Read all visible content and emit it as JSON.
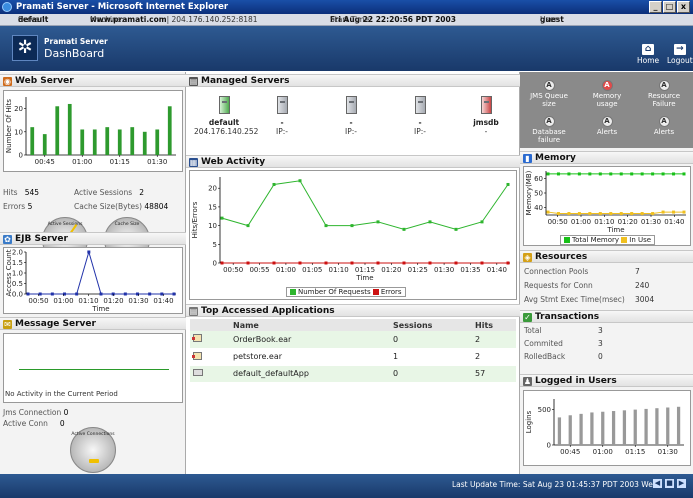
{
  "window": {
    "title": "Pramati Server - Microsoft Internet Explorer",
    "min": "_",
    "max": "□",
    "close": "x"
  },
  "infobar": {
    "server_label": "Server:",
    "server": "default",
    "machine_label": "Machine:",
    "machine": "www.pramati.com",
    "machine_addr": "| 204.176.140.252:8181",
    "start_label": "Start Time:",
    "start": "Fri Aug 22 22:20:56 PDT 2003",
    "user_label": "User:",
    "user": "guest"
  },
  "brand": {
    "top": "Pramati Server",
    "main": "DashBoard",
    "home": "Home",
    "logout": "Logout",
    "home_icon": "home-icon",
    "logout_icon": "logout-icon"
  },
  "web_server": {
    "title": "Web Server",
    "icon": "globe-icon",
    "hits_label": "Hits",
    "hits": "545",
    "sessions_label": "Active Sessions",
    "sessions": "2",
    "errors_label": "Errors",
    "errors": "5",
    "cache_label": "Cache Size(Bytes)",
    "cache": "48804",
    "gauge1": "Active Sessions",
    "gauge2": "Cache Size"
  },
  "ejb_server": {
    "title": "EJB Server",
    "icon": "bean-icon"
  },
  "message_server": {
    "title": "Message Server",
    "icon": "envelope-icon",
    "no_activity": "No Activity in the Current Period",
    "jms_label": "Jms Connection",
    "jms": "0",
    "active_label": "Active Conn",
    "active": "0",
    "gauge": "Active Connections"
  },
  "managed_servers": {
    "title": "Managed Servers",
    "icon": "servers-icon",
    "servers": [
      {
        "name": "default",
        "ip": "204.176.140.252"
      },
      {
        "name": "-",
        "ip": "IP:-"
      },
      {
        "name": "-",
        "ip": "IP:-"
      },
      {
        "name": "-",
        "ip": "IP:-"
      },
      {
        "name": "jmsdb",
        "ip": "-"
      }
    ]
  },
  "web_activity": {
    "title": "Web Activity",
    "icon": "chart-icon"
  },
  "top_apps": {
    "title": "Top Accessed Applications",
    "icon": "document-icon",
    "headers": [
      "Name",
      "Sessions",
      "Hits"
    ],
    "rows": [
      {
        "name": "OrderBook.ear",
        "sessions": "0",
        "hits": "2",
        "icon": "ear-icon"
      },
      {
        "name": "petstore.ear",
        "sessions": "1",
        "hits": "2",
        "icon": "ear-icon"
      },
      {
        "name": "default_defaultApp",
        "sessions": "0",
        "hits": "57",
        "icon": "folder-icon"
      }
    ]
  },
  "alerts": [
    {
      "label": "JMS Queue size",
      "state": "ok"
    },
    {
      "label": "Memory usage",
      "state": "alert"
    },
    {
      "label": "Resource Failure",
      "state": "ok"
    },
    {
      "label": "Database failure",
      "state": "ok"
    },
    {
      "label": "Alerts",
      "state": "ok"
    },
    {
      "label": "Alerts",
      "state": "ok"
    }
  ],
  "memory": {
    "title": "Memory",
    "icon": "battery-icon"
  },
  "resources": {
    "title": "Resources",
    "icon": "resource-icon",
    "rows": [
      {
        "label": "Connection Pools",
        "value": "7"
      },
      {
        "label": "Requests for Conn",
        "value": "240"
      },
      {
        "label": "Avg Stmt Exec Time(msec)",
        "value": "3004"
      }
    ]
  },
  "transactions": {
    "title": "Transactions",
    "icon": "check-icon",
    "rows": [
      {
        "label": "Total",
        "value": "3"
      },
      {
        "label": "Commited",
        "value": "3"
      },
      {
        "label": "RolledBack",
        "value": "0"
      }
    ]
  },
  "logged_users": {
    "title": "Logged in Users",
    "icon": "user-icon"
  },
  "status": {
    "text": "Last Update Time: Sat Aug 23 01:45:37 PDT 2003 Web"
  },
  "chart_data": [
    {
      "type": "bar",
      "id": "web-hits",
      "xticks": [
        "00:45",
        "01:00",
        "01:15",
        "01:30"
      ],
      "ylabel": "Number Of Hits",
      "yticks": [
        0,
        10,
        20
      ],
      "ylim": [
        0,
        25
      ],
      "values": [
        12,
        9,
        21,
        22,
        11,
        11,
        12,
        11,
        12,
        10,
        11,
        21
      ],
      "color": "#2e9a2e"
    },
    {
      "type": "line",
      "id": "ejb-access",
      "xticks": [
        "00:50",
        "01:00",
        "01:10",
        "01:20",
        "01:30",
        "01:40"
      ],
      "xlabel": "Time",
      "ylabel": "Access Count",
      "yticks": [
        "0.0",
        "0.5",
        "1.0",
        "1.5",
        "2.0"
      ],
      "ylim": [
        0,
        2
      ],
      "values": [
        0,
        0,
        0,
        0,
        0,
        2,
        0,
        0,
        0,
        0,
        0,
        0,
        0
      ],
      "color": "#2233aa"
    },
    {
      "type": "line",
      "id": "web-activity",
      "categories": [
        "00:50",
        "00:55",
        "01:00",
        "01:05",
        "01:10",
        "01:15",
        "01:20",
        "01:25",
        "01:30",
        "01:35",
        "01:40"
      ],
      "xlabel": "Time",
      "ylabel": "Hits/Errors",
      "yticks": [
        0,
        5,
        10,
        15,
        20
      ],
      "ylim": [
        0,
        23
      ],
      "series": [
        {
          "name": "Number Of Requests",
          "color": "#2eb52e",
          "values": [
            12,
            10,
            21,
            22,
            10,
            10,
            11,
            9,
            11,
            9,
            11,
            21
          ]
        },
        {
          "name": "Errors",
          "color": "#cc1111",
          "values": [
            0,
            0,
            0,
            0,
            0,
            0,
            0,
            0,
            0,
            0,
            0,
            0
          ]
        }
      ]
    },
    {
      "type": "line",
      "id": "memory",
      "categories": [
        "00:50",
        "01:00",
        "01:10",
        "01:20",
        "01:30",
        "01:40"
      ],
      "xlabel": "Time",
      "ylabel": "Memory(MB)",
      "yticks": [
        40,
        50,
        60
      ],
      "ylim": [
        35,
        65
      ],
      "series": [
        {
          "name": "Total Memory",
          "color": "#18c018",
          "values": [
            63,
            63,
            63,
            63,
            63,
            63,
            63,
            63,
            63,
            63,
            63,
            63,
            63,
            63
          ]
        },
        {
          "name": "In Use",
          "color": "#f0c020",
          "values": [
            37,
            36,
            36,
            36,
            36,
            36,
            36,
            36,
            36,
            36,
            36,
            37,
            37,
            37
          ]
        }
      ]
    },
    {
      "type": "bar",
      "id": "logins",
      "xticks": [
        "00:45",
        "01:00",
        "01:15",
        "01:30"
      ],
      "ylabel": "Logins",
      "yticks": [
        0,
        500
      ],
      "ylim": [
        0,
        650
      ],
      "values": [
        390,
        420,
        440,
        460,
        470,
        480,
        490,
        500,
        510,
        520,
        530,
        540
      ],
      "color": "#999999"
    }
  ]
}
